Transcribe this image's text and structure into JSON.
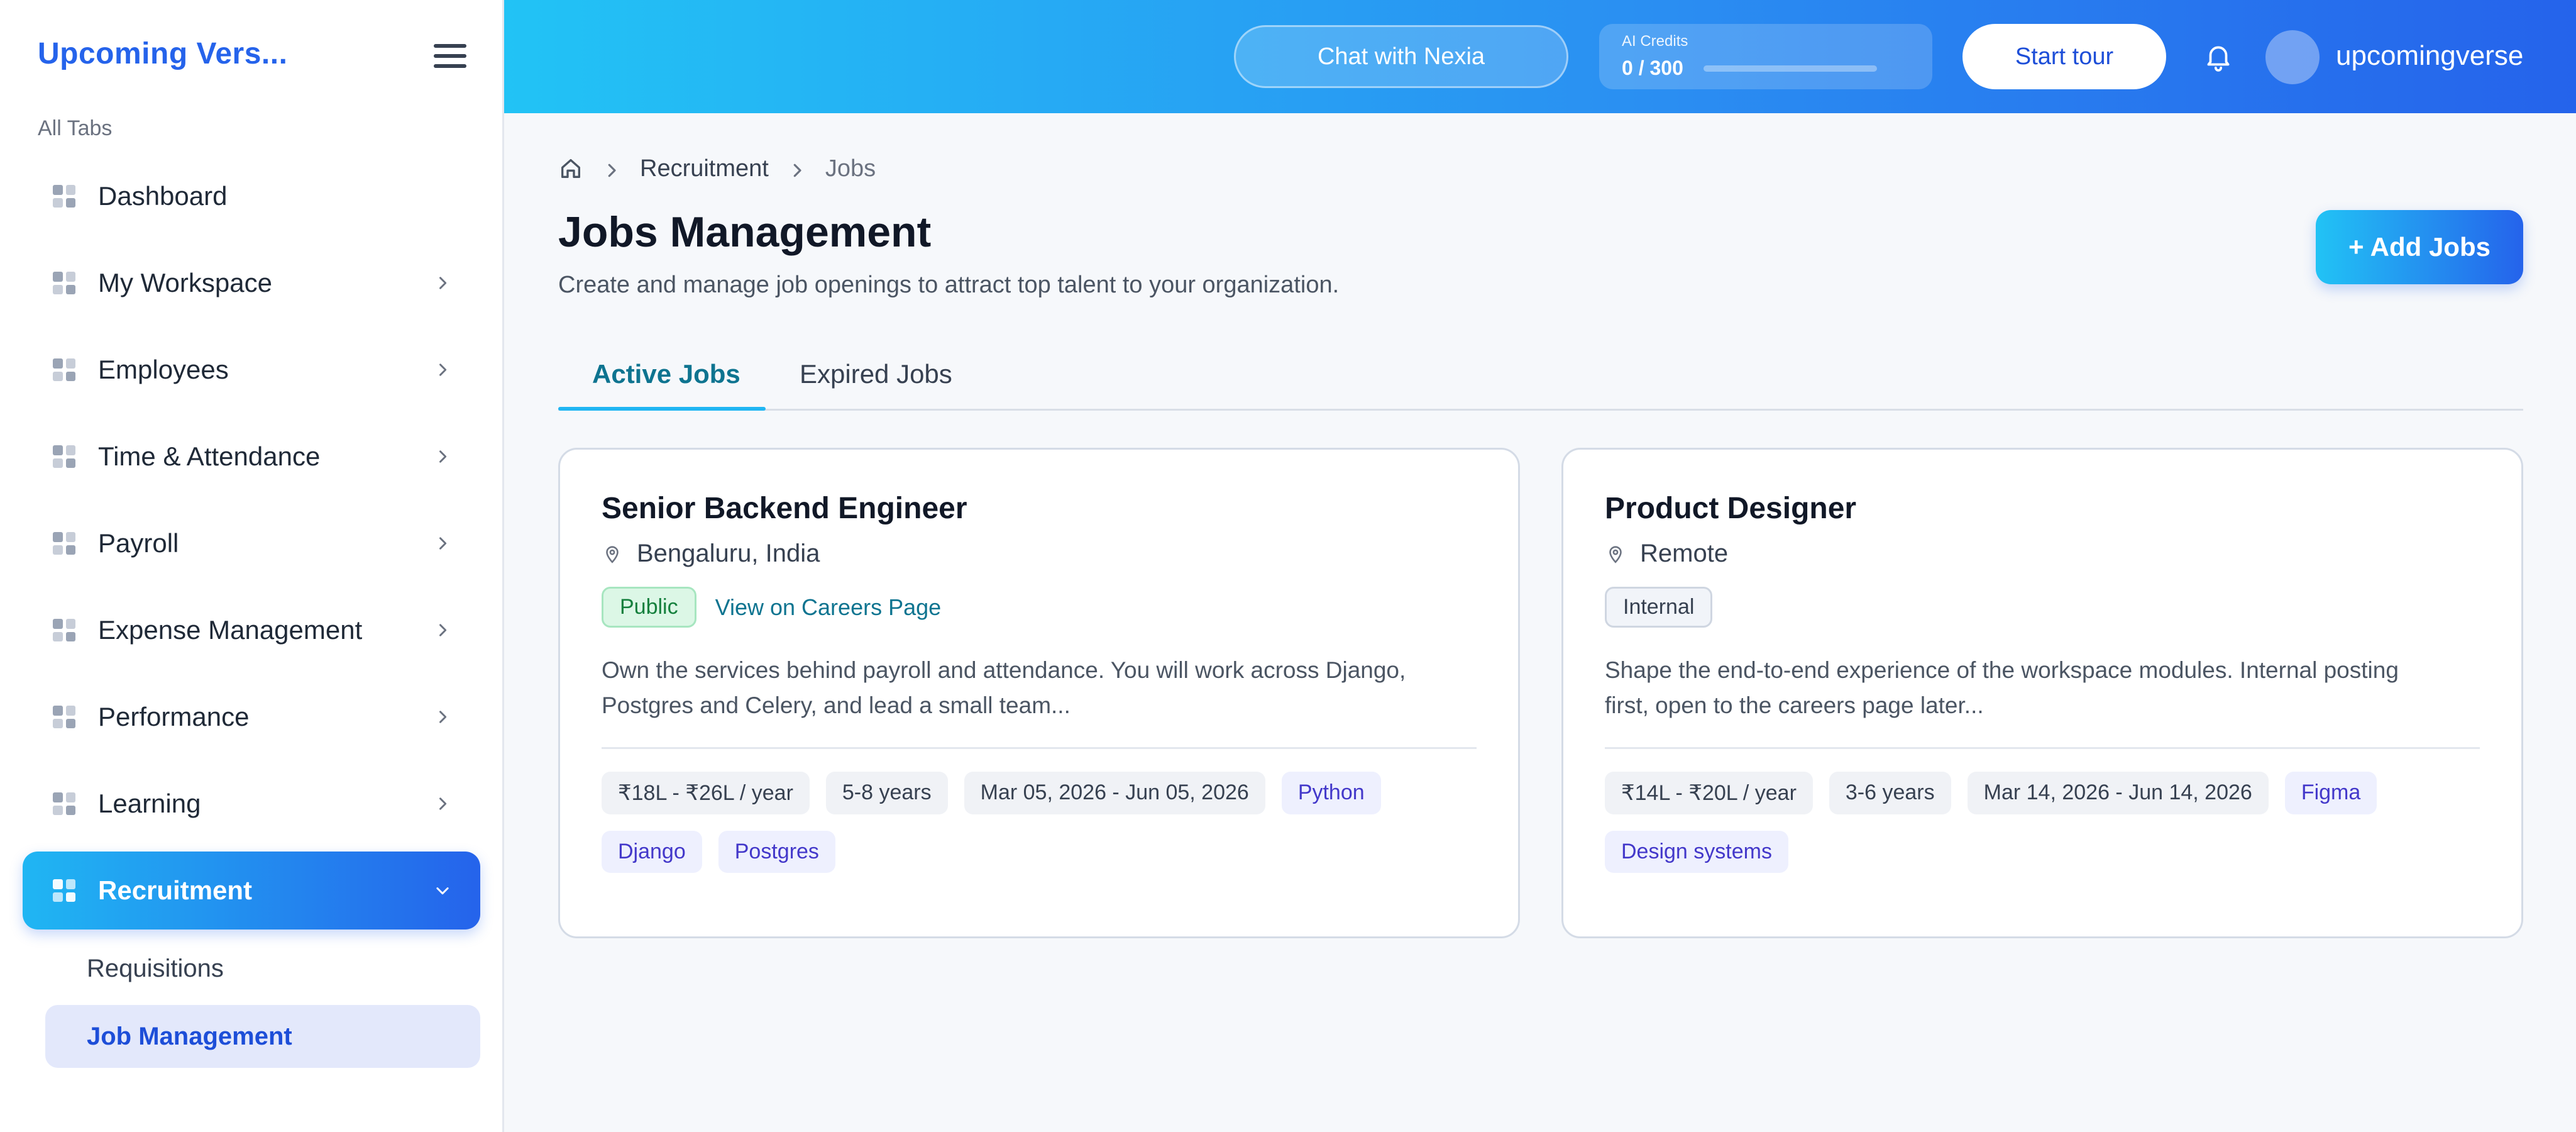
{
  "sidebar": {
    "brand": "Upcoming Vers...",
    "section_label": "All Tabs",
    "items": [
      {
        "label": "Dashboard"
      },
      {
        "label": "My Workspace"
      },
      {
        "label": "Employees"
      },
      {
        "label": "Time & Attendance"
      },
      {
        "label": "Payroll"
      },
      {
        "label": "Expense Management"
      },
      {
        "label": "Performance"
      },
      {
        "label": "Learning"
      },
      {
        "label": "Recruitment"
      }
    ],
    "sub_items": [
      {
        "label": "Requisitions"
      },
      {
        "label": "Job Management"
      }
    ]
  },
  "topbar": {
    "chat_label": "Chat with Nexia",
    "credits_label": "AI Credits",
    "credits_value": "0 / 300",
    "credits_fraction": 0,
    "tour_label": "Start tour",
    "username": "upcomingverse"
  },
  "breadcrumb": {
    "items": [
      "Recruitment",
      "Jobs"
    ]
  },
  "page": {
    "title": "Jobs Management",
    "subtitle": "Create and manage job openings to attract top talent to your organization.",
    "add_button": "+ Add Jobs"
  },
  "tabs": [
    {
      "label": "Active Jobs"
    },
    {
      "label": "Expired Jobs"
    }
  ],
  "jobs": [
    {
      "title": "Senior Backend Engineer",
      "location": "Bengaluru, India",
      "visibility": "Public",
      "careers_link": "View on Careers Page",
      "description": "Own the services behind payroll and attendance. You will work across Django, Postgres and Celery, and lead a small team...",
      "salary": "₹18L - ₹26L / year",
      "experience": "5-8 years",
      "dates": "Mar 05, 2026 - Jun 05, 2026",
      "skills": [
        "Python",
        "Django",
        "Postgres"
      ]
    },
    {
      "title": "Product Designer",
      "location": "Remote",
      "visibility": "Internal",
      "description": "Shape the end-to-end experience of the workspace modules. Internal posting first, open to the careers page later...",
      "salary": "₹14L - ₹20L / year",
      "experience": "3-6 years",
      "dates": "Mar 14, 2026 - Jun 14, 2026",
      "skills": [
        "Figma",
        "Design systems"
      ]
    }
  ],
  "colors": {
    "accent": "#2563eb",
    "accent_light": "#22c3f5",
    "tab_active": "#0e7490"
  }
}
